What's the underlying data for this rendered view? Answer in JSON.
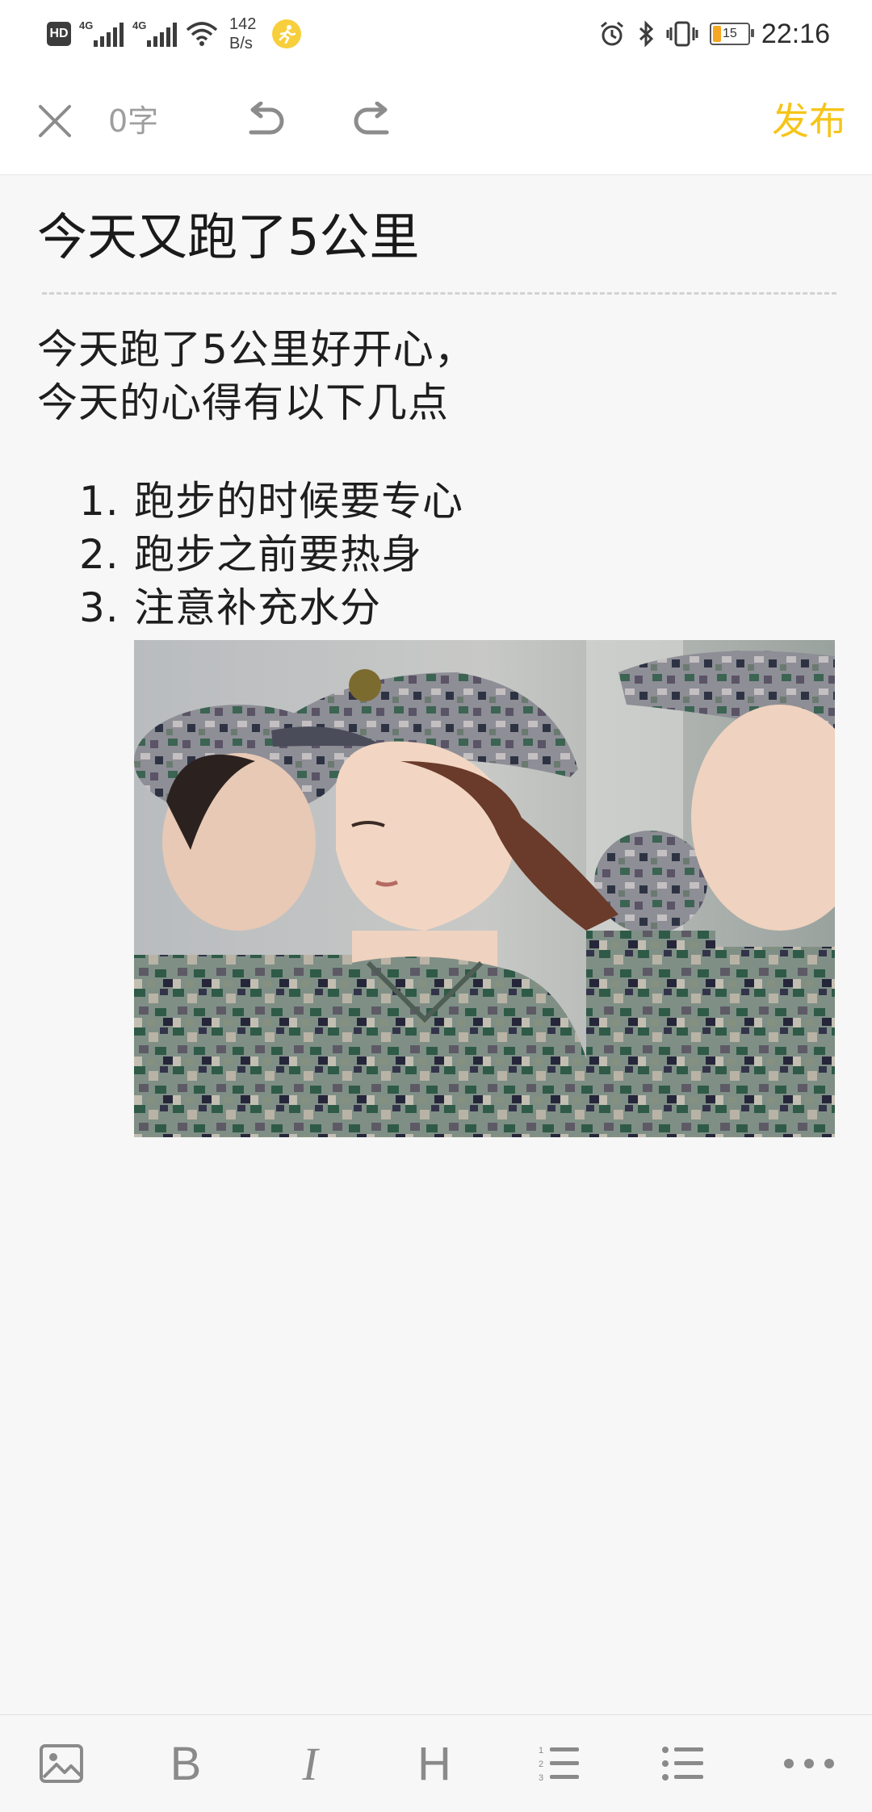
{
  "status_bar": {
    "hd": "HD",
    "sim1": "4G",
    "sim2": "4G",
    "net_speed_value": "142",
    "net_speed_unit": "B/s",
    "battery": "15",
    "time": "22:16",
    "icons": [
      "hd-icon",
      "signal-icon",
      "signal-icon",
      "wifi-icon",
      "running-app-icon",
      "alarm-icon",
      "bluetooth-icon",
      "vibrate-icon",
      "battery-icon"
    ]
  },
  "toolbar": {
    "word_count": "0字",
    "publish_label": "发布",
    "accent_color": "#f5c518",
    "icons": [
      "close-icon",
      "undo-icon",
      "redo-icon"
    ]
  },
  "editor": {
    "title": "今天又跑了5公里",
    "paragraph_lines": [
      "今天跑了5公里好开心，",
      "今天的心得有以下几点"
    ],
    "list": [
      {
        "num": "1.",
        "text": "跑步的时候要专心"
      },
      {
        "num": "2.",
        "text": "跑步之前要热身"
      },
      {
        "num": "3.",
        "text": "注意补充水分"
      }
    ],
    "image_icon": "photo-of-people-in-camouflage"
  },
  "format_bar": {
    "bold_label": "B",
    "italic_label": "I",
    "heading_label": "H",
    "icons": [
      "image-icon",
      "bold-icon",
      "italic-icon",
      "heading-icon",
      "numbered-list-icon",
      "bulleted-list-icon",
      "more-icon"
    ]
  }
}
